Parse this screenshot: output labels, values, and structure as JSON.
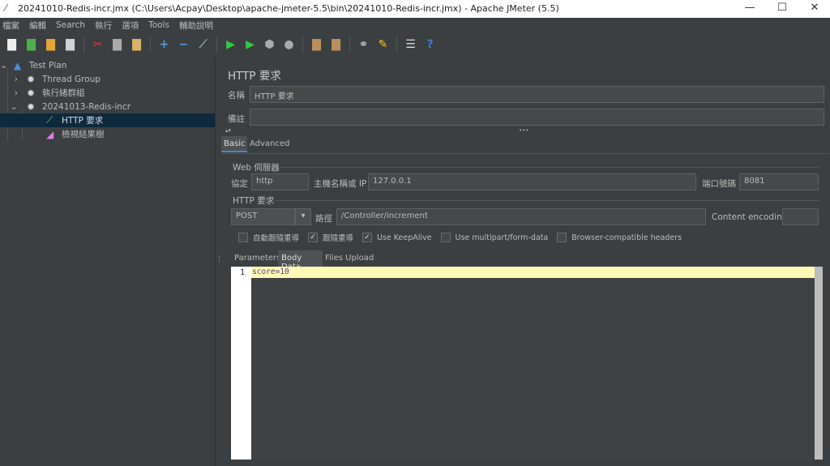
{
  "window": {
    "title": "20241010-Redis-incr.jmx (C:\\Users\\Acpay\\Desktop\\apache-jmeter-5.5\\bin\\20241010-Redis-incr.jmx) - Apache JMeter (5.5)",
    "minimize": "—",
    "maximize": "☐",
    "close": "✕"
  },
  "menu": [
    "檔案",
    "編輯",
    "Search",
    "執行",
    "選項",
    "Tools",
    "輔助說明"
  ],
  "toolbar": [
    {
      "icon": "new-icon",
      "g": "▇",
      "c": "#eee"
    },
    {
      "icon": "templates-icon",
      "g": "▇",
      "c": "#4caf50"
    },
    {
      "icon": "open-icon",
      "g": "▇",
      "c": "#e8a53c"
    },
    {
      "icon": "save-icon",
      "g": "▇",
      "c": "#cfd3d8"
    },
    {
      "sep": true
    },
    {
      "icon": "cut-icon",
      "g": "✂",
      "c": "#e53935"
    },
    {
      "icon": "copy-icon",
      "g": "▇",
      "c": "#aaa"
    },
    {
      "icon": "paste-icon",
      "g": "▇",
      "c": "#d9b26b"
    },
    {
      "sep": true
    },
    {
      "icon": "expand-icon",
      "g": "+",
      "c": "#4a9ee8"
    },
    {
      "icon": "collapse-icon",
      "g": "−",
      "c": "#4a9ee8"
    },
    {
      "icon": "toggle-icon",
      "g": "⟋",
      "c": "#8ab"
    },
    {
      "sep": true
    },
    {
      "icon": "start-icon",
      "g": "▶",
      "c": "#2ecc40"
    },
    {
      "icon": "start-no-pause-icon",
      "g": "▶",
      "c": "#2ecc40"
    },
    {
      "icon": "stop-icon",
      "g": "⬢",
      "c": "#aaa"
    },
    {
      "icon": "shutdown-icon",
      "g": "●",
      "c": "#aaa"
    },
    {
      "sep": true
    },
    {
      "icon": "clear-icon",
      "g": "▇",
      "c": "#b9905a"
    },
    {
      "icon": "clear-all-icon",
      "g": "▇",
      "c": "#b9905a"
    },
    {
      "sep": true
    },
    {
      "icon": "search-icon",
      "g": "⚭",
      "c": "#ccc"
    },
    {
      "icon": "reset-search-icon",
      "g": "✎",
      "c": "#f1c40f"
    },
    {
      "sep": true
    },
    {
      "icon": "function-helper-icon",
      "g": "☰",
      "c": "#ddd"
    },
    {
      "icon": "help-icon",
      "g": "?",
      "c": "#3b7fd4"
    }
  ],
  "tree": [
    {
      "label": "Test Plan",
      "depth": 0,
      "arrow": "⌄",
      "icon": "flask-icon"
    },
    {
      "label": "Thread Group",
      "depth": 1,
      "arrow": "›",
      "icon": "gear-icon"
    },
    {
      "label": "執行緒群組",
      "depth": 1,
      "arrow": "›",
      "icon": "gear-icon"
    },
    {
      "label": "20241013-Redis-incr",
      "depth": 1,
      "arrow": "⌄",
      "icon": "gear-icon"
    },
    {
      "label": "HTTP 要求",
      "depth": 2,
      "arrow": "",
      "icon": "pipette-icon",
      "selected": true
    },
    {
      "label": "檢視結果樹",
      "depth": 2,
      "arrow": "",
      "icon": "chart-icon"
    }
  ],
  "panel": {
    "title": "HTTP 要求",
    "name_label": "名稱",
    "name_value": "HTTP 要求",
    "comment_label": "備註",
    "comment_value": "",
    "tabs": [
      "Basic",
      "Advanced"
    ],
    "web_server": "Web 伺服器",
    "protocol_label": "協定",
    "protocol_value": "http",
    "host_label": "主機名稱或 IP",
    "host_value": "127.0.0.1",
    "port_label": "端口號碼",
    "port_value": "8081",
    "http_request": "HTTP 要求",
    "method": "POST",
    "path_label": "路徑",
    "path_value": "/Controller/increment",
    "encoding_label": "Content encoding:",
    "encoding_value": "",
    "checkboxes": [
      {
        "label": "自動跟隨重導",
        "checked": false
      },
      {
        "label": "跟隨重導",
        "checked": true
      },
      {
        "label": "Use KeepAlive",
        "checked": true
      },
      {
        "label": "Use multipart/form-data",
        "checked": false
      },
      {
        "label": "Browser-compatible headers",
        "checked": false
      }
    ],
    "subtabs": [
      "Parameters",
      "Body Data",
      "Files Upload"
    ],
    "body": {
      "line": "1",
      "text": "score=10"
    }
  }
}
